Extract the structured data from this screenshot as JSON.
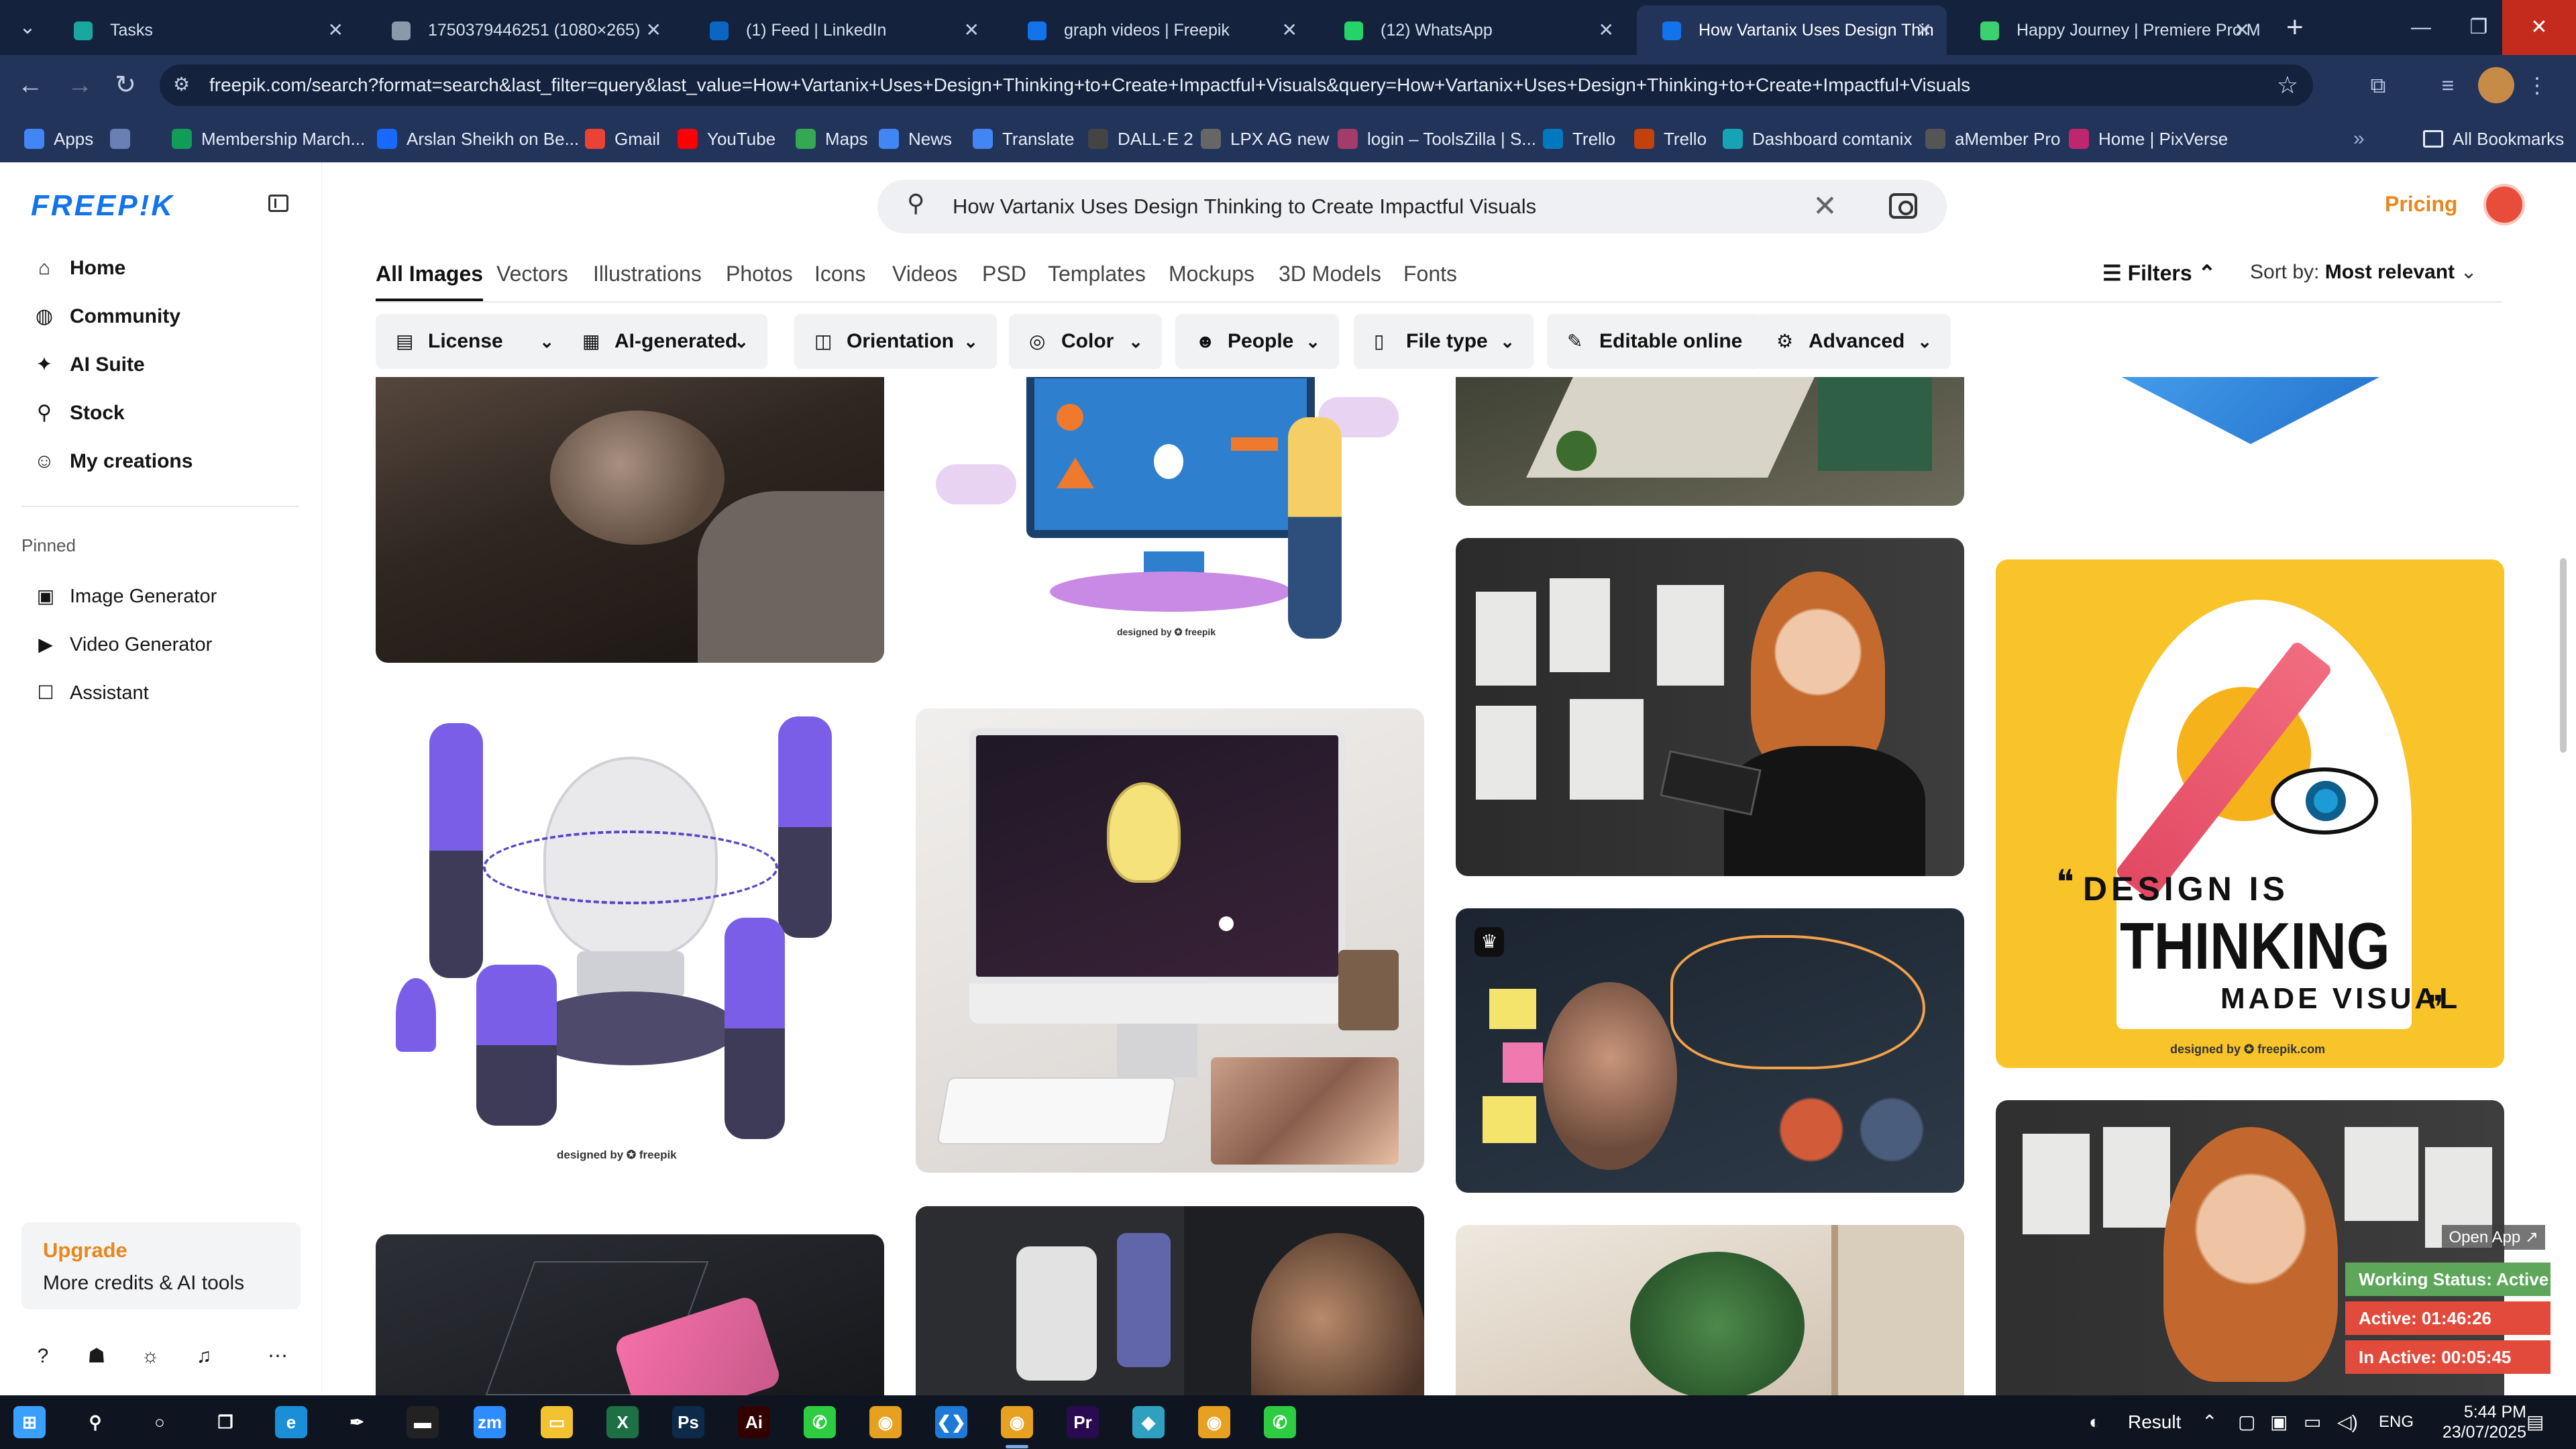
{
  "browser": {
    "tabs": [
      {
        "title": "Tasks",
        "color": "#1aa7a0",
        "active": false
      },
      {
        "title": "1750379446251 (1080×265)",
        "color": "#8d98ab",
        "active": false
      },
      {
        "title": "(1) Feed | LinkedIn",
        "color": "#0a66c2",
        "active": false
      },
      {
        "title": "graph videos | Freepik",
        "color": "#1273eb",
        "active": false
      },
      {
        "title": "(12) WhatsApp",
        "color": "#25d366",
        "active": false
      },
      {
        "title": "How Vartanix Uses Design Thin",
        "color": "#1273eb",
        "active": true
      },
      {
        "title": "Happy Journey | Premiere Pro M",
        "color": "#3bd16f",
        "active": false
      }
    ],
    "new_tab": "+",
    "url": "freepik.com/search?format=search&last_filter=query&last_value=How+Vartanix+Uses+Design+Thinking+to+Create+Impactful+Visuals&query=How+Vartanix+Uses+Design+Thinking+to+Create+Impactful+Visuals",
    "bookmarks": [
      {
        "label": "Apps",
        "color": "#4285f4"
      },
      {
        "label": "",
        "color": "#6a7fb3"
      },
      {
        "label": "Membership March...",
        "color": "#0f9d58"
      },
      {
        "label": "Arslan Sheikh on Be...",
        "color": "#1769ff"
      },
      {
        "label": "Gmail",
        "color": "#ea4335"
      },
      {
        "label": "YouTube",
        "color": "#ff0000"
      },
      {
        "label": "Maps",
        "color": "#34a853"
      },
      {
        "label": "News",
        "color": "#4285f4"
      },
      {
        "label": "Translate",
        "color": "#4285f4"
      },
      {
        "label": "DALL·E 2",
        "color": "#444444"
      },
      {
        "label": "LPX AG new",
        "color": "#666666"
      },
      {
        "label": "login – ToolsZilla | S...",
        "color": "#a33c6b"
      },
      {
        "label": "Trello",
        "color": "#0079bf"
      },
      {
        "label": "Trello",
        "color": "#c2410c"
      },
      {
        "label": "Dashboard comtanix",
        "color": "#16a3b4"
      },
      {
        "label": "aMember Pro",
        "color": "#555555"
      },
      {
        "label": "Home | PixVerse",
        "color": "#c0266d"
      }
    ],
    "bookmarks_more": "»",
    "all_bookmarks": "All Bookmarks"
  },
  "sidebar": {
    "logo": "FREEP!K",
    "nav": [
      {
        "label": "Home",
        "icon": "home-icon",
        "glyph": "⌂"
      },
      {
        "label": "Community",
        "icon": "globe-icon",
        "glyph": "◍"
      },
      {
        "label": "AI Suite",
        "icon": "sparkle-icon",
        "glyph": "✦"
      },
      {
        "label": "Stock",
        "icon": "search-icon",
        "glyph": "⚲"
      },
      {
        "label": "My creations",
        "icon": "person-icon",
        "glyph": "☺"
      }
    ],
    "pinned_title": "Pinned",
    "pinned": [
      {
        "label": "Image Generator",
        "icon": "image-icon",
        "glyph": "▣"
      },
      {
        "label": "Video Generator",
        "icon": "video-icon",
        "glyph": "▶"
      },
      {
        "label": "Assistant",
        "icon": "chat-icon",
        "glyph": "☐"
      }
    ],
    "upgrade_title": "Upgrade",
    "upgrade_text": "More credits & AI tools"
  },
  "search": {
    "query": "How Vartanix Uses Design Thinking to Create Impactful Visuals",
    "clear": "✕"
  },
  "header": {
    "pricing": "Pricing"
  },
  "content_types": [
    "All Images",
    "Vectors",
    "Illustrations",
    "Photos",
    "Icons",
    "Videos",
    "PSD",
    "Templates",
    "Mockups",
    "3D Models",
    "Fonts"
  ],
  "filters_label": "Filters",
  "sort_label": "Sort by:",
  "sort_value": "Most relevant",
  "filter_chips": [
    {
      "label": "License",
      "icon": "license-icon",
      "glyph": "▤",
      "chevron": true
    },
    {
      "label": "AI-generated",
      "icon": "ai-icon",
      "glyph": "▦",
      "chevron": true
    },
    {
      "label": "Orientation",
      "icon": "orientation-icon",
      "glyph": "◫",
      "chevron": true
    },
    {
      "label": "Color",
      "icon": "color-icon",
      "glyph": "◎",
      "chevron": true
    },
    {
      "label": "People",
      "icon": "people-icon",
      "glyph": "☻",
      "chevron": true
    },
    {
      "label": "File type",
      "icon": "file-icon",
      "glyph": "▯",
      "chevron": true
    },
    {
      "label": "Editable online",
      "icon": "pencil-icon",
      "glyph": "✎",
      "chevron": false
    },
    {
      "label": "Advanced",
      "icon": "gear-icon",
      "glyph": "⚙",
      "chevron": true
    }
  ],
  "cards": {
    "credit": "designed by ✪ freepik",
    "credit_small": "designed by ✪ freepik.com",
    "poster_line1": "DESIGN IS",
    "poster_line2": "THINKING",
    "poster_line3": "MADE VISUAL",
    "poster_quote_open": "❝",
    "poster_quote_close": "❞"
  },
  "overlay": {
    "open_app": "Open App ↗",
    "working_status": "Working Status: Active",
    "active": "Active: 01:46:26",
    "inactive": "In Active: 00:05:45"
  },
  "taskbar": {
    "weather": "Result",
    "lang": "ENG",
    "time": "5:44 PM",
    "date": "23/07/2025",
    "apps": [
      {
        "name": "start",
        "glyph": "⊞",
        "color": "#3aa0ff"
      },
      {
        "name": "search",
        "glyph": "⚲",
        "color": "transparent"
      },
      {
        "name": "cortana",
        "glyph": "○",
        "color": "transparent"
      },
      {
        "name": "task-view",
        "glyph": "❐",
        "color": "transparent"
      },
      {
        "name": "edge",
        "glyph": "e",
        "color": "#1a8fd8"
      },
      {
        "name": "pen-tool",
        "glyph": "✒",
        "color": "transparent"
      },
      {
        "name": "terminal",
        "glyph": "▬",
        "color": "#222222"
      },
      {
        "name": "zoom",
        "glyph": "zm",
        "color": "#2d8cff"
      },
      {
        "name": "file-explorer",
        "glyph": "▭",
        "color": "#f2c230"
      },
      {
        "name": "excel",
        "glyph": "X",
        "color": "#1d7044"
      },
      {
        "name": "photoshop",
        "glyph": "Ps",
        "color": "#0d2a4a"
      },
      {
        "name": "illustrator",
        "glyph": "Ai",
        "color": "#330000"
      },
      {
        "name": "phone-app",
        "glyph": "✆",
        "color": "#2ecc40"
      },
      {
        "name": "chrome",
        "glyph": "◉",
        "color": "#e8a020"
      },
      {
        "name": "vscode",
        "glyph": "❮❯",
        "color": "#1e7ad6"
      },
      {
        "name": "chrome-active",
        "glyph": "◉",
        "color": "#e8a020"
      },
      {
        "name": "premiere",
        "glyph": "Pr",
        "color": "#2a0b52"
      },
      {
        "name": "app-diamond",
        "glyph": "◆",
        "color": "#30a0c0"
      },
      {
        "name": "chrome-2",
        "glyph": "◉",
        "color": "#e8a020"
      },
      {
        "name": "phone-app-2",
        "glyph": "✆",
        "color": "#2ecc40"
      }
    ]
  }
}
